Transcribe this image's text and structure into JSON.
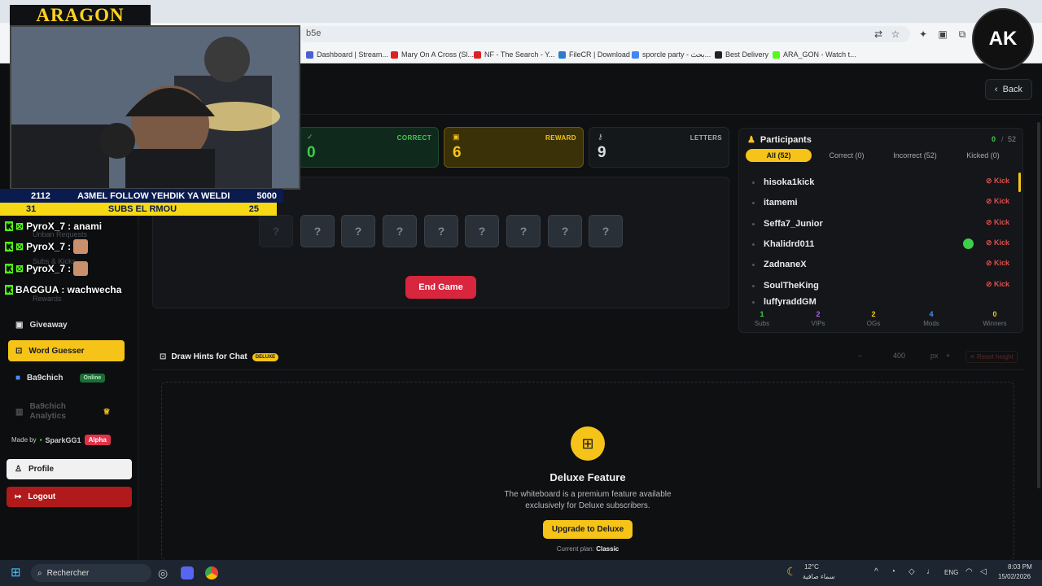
{
  "browser": {
    "url": "b5e",
    "bookmarks": [
      "Dashboard | Stream...",
      "Mary On A Cross (Sl...",
      "NF - The Search - Y...",
      "FileCR | Download",
      "sporcle party - بحث...",
      "Best Delivery",
      "ARA_GON - Watch t..."
    ],
    "bookmark_colors": [
      "#4a5fd6",
      "#e02020",
      "#e02020",
      "#2b7bd1",
      "#4285f4",
      "#222",
      "#53fc18"
    ]
  },
  "header": {
    "back_label": "Back"
  },
  "stats": {
    "correct": {
      "label": "CORRECT",
      "value": "0"
    },
    "reward": {
      "label": "REWARD",
      "value": "6"
    },
    "letters": {
      "label": "LETTERS",
      "value": "9"
    }
  },
  "game": {
    "hidden_letters": [
      "?",
      "?",
      "?",
      "?",
      "?",
      "?",
      "?",
      "?",
      "?"
    ],
    "end_button": "End Game"
  },
  "participants": {
    "title": "Participants",
    "correct_count": "0",
    "separator": "/",
    "total": "52",
    "filters": [
      "All (52)",
      "Correct (0)",
      "Incorrect (52)",
      "Kicked (0)"
    ],
    "kick_label": "Kick",
    "rows": [
      "hisoka1kick",
      "itamemi",
      "Seffa7_Junior",
      "Khalidrd011",
      "ZadnaneX",
      "SoulTheKing",
      "luffyraddGM"
    ],
    "stats": [
      {
        "value": "1",
        "label": "Subs",
        "color": "#3ecf4a"
      },
      {
        "value": "2",
        "label": "VIPs",
        "color": "#b45cf0"
      },
      {
        "value": "2",
        "label": "OGs",
        "color": "#f6c419"
      },
      {
        "value": "4",
        "label": "Mods",
        "color": "#4c8df6"
      },
      {
        "value": "0",
        "label": "Winners",
        "color": "#f6c419"
      }
    ]
  },
  "draw_hints": {
    "title": "Draw Hints for Chat",
    "badge": "DELUXE",
    "height_value": "400",
    "height_unit": "px",
    "minus": "−",
    "plus": "+",
    "reset": "Reset height",
    "feature_title": "Deluxe Feature",
    "feature_desc": "The whiteboard is a premium feature available exclusively for Deluxe subscribers.",
    "upgrade_label": "Upgrade to Deluxe",
    "plan_prefix": "Current plan:",
    "plan_name": "Classic"
  },
  "sidebar": {
    "ghost_items": [
      "Unban Requests",
      "Subs & Kicks",
      "Rewards"
    ],
    "items": [
      {
        "label": "Giveaway",
        "icon": "gift-icon"
      },
      {
        "label": "Word Guesser",
        "icon": "gamepad-icon",
        "active": true
      },
      {
        "label": "Ba9chich",
        "icon": "ba9chich-icon",
        "badge": "Online"
      },
      {
        "label": "Ba9chich Analytics",
        "icon": "chart-icon"
      }
    ],
    "made_by_prefix": "Made by",
    "author": "SparkGG1",
    "alpha": "Alpha",
    "profile": "Profile",
    "logout": "Logout"
  },
  "overlay": {
    "brand": "ARAGON",
    "goal_line1_left": "2112",
    "goal_line1_text": "A3MEL FOLLOW YEHDIK YA WELDI",
    "goal_line1_right": "5000",
    "goal_line2_left": "31",
    "goal_line2_text": "SUBS EL RMOU",
    "goal_line2_right": "25",
    "chat": [
      {
        "user": "PyroX_7",
        "msg": ": anami"
      },
      {
        "user": "PyroX_7",
        "msg": ":"
      },
      {
        "user": "PyroX_7",
        "msg": ":"
      },
      {
        "user": "BAGGUA",
        "msg": ": wachwecha"
      }
    ],
    "logo_text": "AK"
  },
  "taskbar": {
    "search_placeholder": "Rechercher",
    "temp": "12°C",
    "weather": "سماء صافية",
    "lang": "ENG",
    "time": "8:03 PM",
    "date": "15/02/2026"
  }
}
